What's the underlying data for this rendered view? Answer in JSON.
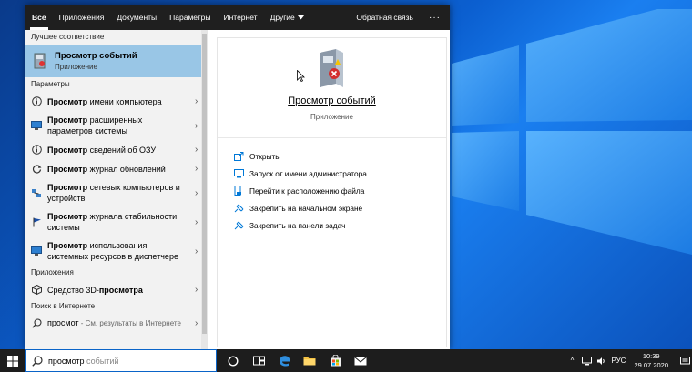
{
  "topbar": {
    "tabs": [
      "Все",
      "Приложения",
      "Документы",
      "Параметры",
      "Интернет"
    ],
    "more_label": "Другие",
    "feedback": "Обратная связь",
    "dots": "···"
  },
  "left": {
    "best_header": "Лучшее соответствие",
    "best": {
      "title": "Просмотр событий",
      "subtitle": "Приложение"
    },
    "settings_header": "Параметры",
    "settings": [
      {
        "bold": "Просмотр",
        "rest": " имени компьютера",
        "icon": "info-icon"
      },
      {
        "bold": "Просмотр",
        "rest": " расширенных параметров системы",
        "icon": "monitor-icon"
      },
      {
        "bold": "Просмотр",
        "rest": " сведений об ОЗУ",
        "icon": "info-icon"
      },
      {
        "bold": "Просмотр",
        "rest": " журнал обновлений",
        "icon": "sync-icon"
      },
      {
        "bold": "Просмотр",
        "rest": " сетевых компьютеров и устройств",
        "icon": "network-icon"
      },
      {
        "bold": "Просмотр",
        "rest": " журнала стабильности системы",
        "icon": "flag-icon"
      },
      {
        "bold": "Просмотр",
        "rest": " использования системных ресурсов в диспетчере",
        "icon": "monitor-icon"
      }
    ],
    "apps_header": "Приложения",
    "apps": [
      {
        "pre": "Средство 3D-",
        "bold": "просмотра",
        "icon": "3d-viewer-icon"
      }
    ],
    "web_header": "Поиск в Интернете",
    "web": {
      "query": "просмот",
      "suffix": " - См. результаты в Интернете"
    }
  },
  "right": {
    "app_name": "Просмотр событий",
    "app_kind": "Приложение",
    "actions": [
      {
        "label": "Открыть",
        "icon": "open-icon"
      },
      {
        "label": "Запуск от имени администратора",
        "icon": "admin-icon"
      },
      {
        "label": "Перейти к расположению файла",
        "icon": "file-location-icon"
      },
      {
        "label": "Закрепить на начальном экране",
        "icon": "pin-icon"
      },
      {
        "label": "Закрепить на панели задач",
        "icon": "pin-icon"
      }
    ]
  },
  "taskbar": {
    "search_typed": "просмотр",
    "search_ghost": " событий",
    "lang": "РУС",
    "time": "10:39",
    "date": "29.07.2020"
  },
  "colors": {
    "accent": "#0078d7",
    "highlight": "#99c6e6",
    "topbar": "#1f1f1f",
    "taskbar": "#1d1d1d"
  }
}
